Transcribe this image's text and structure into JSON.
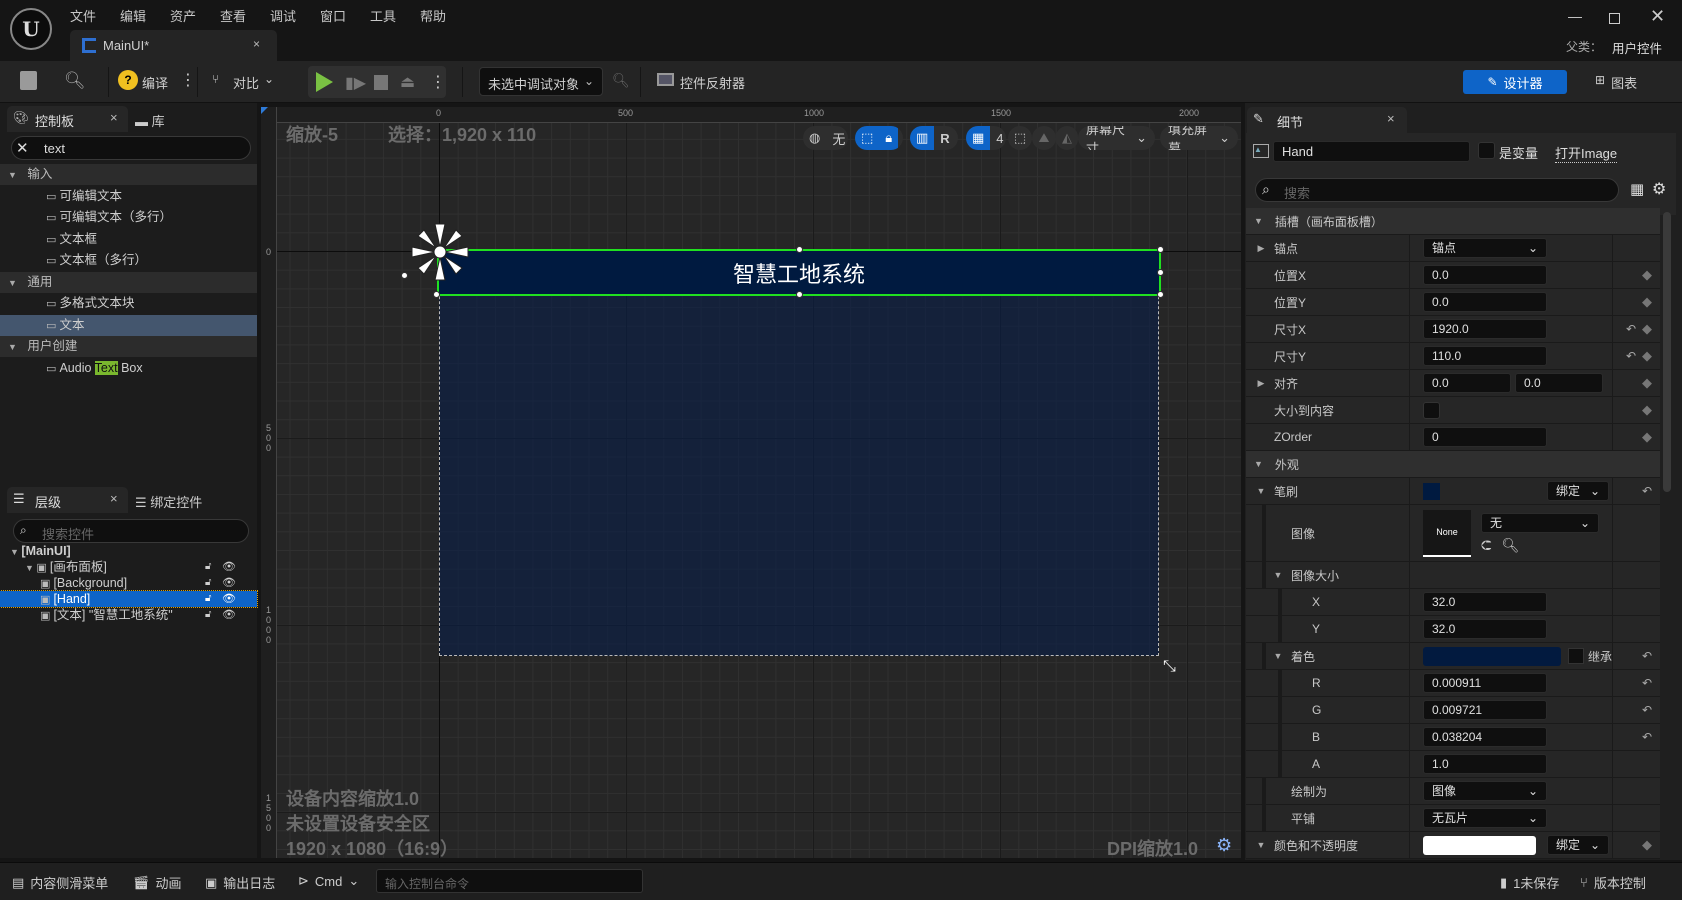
{
  "app": {
    "menu": [
      "文件",
      "编辑",
      "资产",
      "查看",
      "调试",
      "窗口",
      "工具",
      "帮助"
    ],
    "tab": "MainUI*",
    "parent_label": "父类：",
    "parent_value": "用户控件",
    "window_controls": [
      "minimize-icon",
      "maximize-icon",
      "close-icon"
    ]
  },
  "toolbar": {
    "compile": "编译",
    "diff": "对比",
    "debug_target": "未选中调试对象",
    "widget_reflector": "控件反射器",
    "designer": "设计器",
    "graph": "图表"
  },
  "palette": {
    "tab": "控制板",
    "library_tab": "库",
    "search_value": "text",
    "items": [
      {
        "cat": "输入"
      },
      {
        "label": "可编辑文本"
      },
      {
        "label": "可编辑文本（多行）"
      },
      {
        "label": "文本框"
      },
      {
        "label": "文本框（多行）"
      },
      {
        "cat": "通用"
      },
      {
        "label": "多格式文本块"
      },
      {
        "label": "文本",
        "selected": true
      },
      {
        "cat": "用户创建"
      },
      {
        "label": "Audio ",
        "highlight": "Text",
        "rest": " Box"
      }
    ]
  },
  "hierarchy": {
    "tab": "层级",
    "bind_tab": "绑定控件",
    "search_placeholder": "搜索控件",
    "items": [
      {
        "label": "[MainUI]",
        "depth": 0,
        "bold": true
      },
      {
        "label": "[画布面板]",
        "depth": 1
      },
      {
        "label": "[Background]",
        "depth": 2
      },
      {
        "label": "[Hand]",
        "depth": 2,
        "selected": true
      },
      {
        "label": "[文本] \"智慧工地系统\"",
        "depth": 2
      }
    ]
  },
  "canvas": {
    "zoom": "缩放-5",
    "selection": "选择：1,920 x 110",
    "header_text": "智慧工地系统",
    "device_scale": "设备内容缩放1.0",
    "safe_zone": "未设置设备安全区",
    "resolution": "1920 x 1080（16:9）",
    "dpi": "DPI缩放1.0",
    "ruler_x": [
      "0",
      "500",
      "1000",
      "1500",
      "2000"
    ],
    "ruler_y": [
      "0",
      "500",
      "1000",
      "1500"
    ],
    "toolbar": {
      "world": "无",
      "r": "R",
      "grid": "4",
      "screen_size": "屏幕尺寸",
      "fill_screen": "填充屏幕"
    },
    "colors": {
      "header": "#001a40",
      "selection": "#20e020"
    }
  },
  "details": {
    "tab": "细节",
    "name": "Hand",
    "is_variable": "是变量",
    "open": "打开Image",
    "search_placeholder": "搜索",
    "rows": [
      {
        "section": "插槽（画布面板槽）"
      },
      {
        "label": "锚点",
        "arrow": "right",
        "dropdown": "锚点"
      },
      {
        "label": "位置X",
        "input": "0.0",
        "key": true
      },
      {
        "label": "位置Y",
        "input": "0.0",
        "key": true
      },
      {
        "label": "尺寸X",
        "input": "1920.0",
        "reset": true,
        "key": true
      },
      {
        "label": "尺寸Y",
        "input": "110.0",
        "reset": true,
        "key": true
      },
      {
        "label": "对齐",
        "arrow": "right",
        "inputs": [
          "0.0",
          "0.0"
        ],
        "key": true
      },
      {
        "label": "大小到内容",
        "checkbox": true,
        "key": true
      },
      {
        "label": "ZOrder",
        "input": "0",
        "key": true
      },
      {
        "section": "外观"
      },
      {
        "label": "笔刷",
        "arrow": "down",
        "swatch": "#001a40",
        "bind": "绑定",
        "reset": true
      },
      {
        "label": "图像",
        "depth": 1,
        "thumb": "None",
        "dropdown": "无",
        "tall": true
      },
      {
        "label": "图像大小",
        "depth": 1,
        "arrow": "down"
      },
      {
        "label": "X",
        "depth": 2,
        "input": "32.0"
      },
      {
        "label": "Y",
        "depth": 2,
        "input": "32.0"
      },
      {
        "label": "着色",
        "depth": 1,
        "arrow": "down",
        "colorbar": "#021a3f",
        "inherit": "继承",
        "reset": true
      },
      {
        "label": "R",
        "depth": 2,
        "input": "0.000911",
        "reset": true
      },
      {
        "label": "G",
        "depth": 2,
        "input": "0.009721",
        "reset": true
      },
      {
        "label": "B",
        "depth": 2,
        "input": "0.038204",
        "reset": true
      },
      {
        "label": "A",
        "depth": 2,
        "input": "1.0"
      },
      {
        "label": "绘制为",
        "depth": 1,
        "dropdown": "图像"
      },
      {
        "label": "平铺",
        "depth": 1,
        "dropdown": "无瓦片"
      },
      {
        "label": "颜色和不透明度",
        "arrow": "down",
        "whitebar": "#ffffff",
        "bind": "绑定",
        "key": true
      }
    ]
  },
  "statusbar": {
    "content_drawer": "内容侧滑菜单",
    "animation": "动画",
    "output_log": "输出日志",
    "cmd": "Cmd",
    "cmd_placeholder": "输入控制台命令",
    "unsaved": "1未保存",
    "source_control": "版本控制"
  }
}
